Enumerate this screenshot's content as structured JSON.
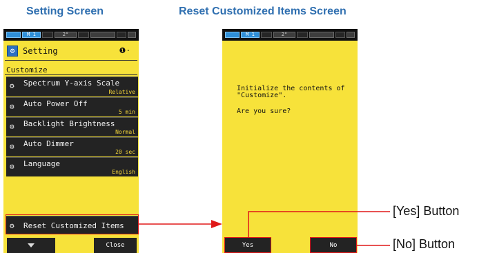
{
  "captions": {
    "left": "Setting Screen",
    "right": "Reset Customized Items Screen"
  },
  "status_bar": {
    "mode": "M 1",
    "angle": "2°",
    "icons": [
      "battery-icon",
      "wireless-icon",
      "card-icon"
    ]
  },
  "setting_screen": {
    "title": "Setting",
    "page_indicator": "❶·",
    "section": "Customize",
    "items": [
      {
        "label": "Spectrum Y-axis Scale",
        "value": "Relative"
      },
      {
        "label": "Auto Power Off",
        "value": "5 min"
      },
      {
        "label": "Backlight Brightness",
        "value": "Normal"
      },
      {
        "label": "Auto Dimmer",
        "value": "20 sec"
      },
      {
        "label": "Language",
        "value": "English"
      }
    ],
    "reset_item": "Reset Customized Items",
    "close_button": "Close",
    "icons": {
      "title": "setting-icon",
      "item": "gear-icon",
      "down": "arrow-down-icon"
    }
  },
  "reset_screen": {
    "message_line1": "Initialize the contents of",
    "message_line2": "\"Customize\".",
    "message_line3": "Are you sure?",
    "yes_button": "Yes",
    "no_button": "No"
  },
  "callouts": {
    "yes": "[Yes] Button",
    "no": "[No] Button"
  },
  "colors": {
    "caption": "#2f6fb0",
    "screen_background": "#f7e23a",
    "menu_item": "#232323",
    "value_text": "#f7d83a",
    "highlight": "#e01818"
  }
}
